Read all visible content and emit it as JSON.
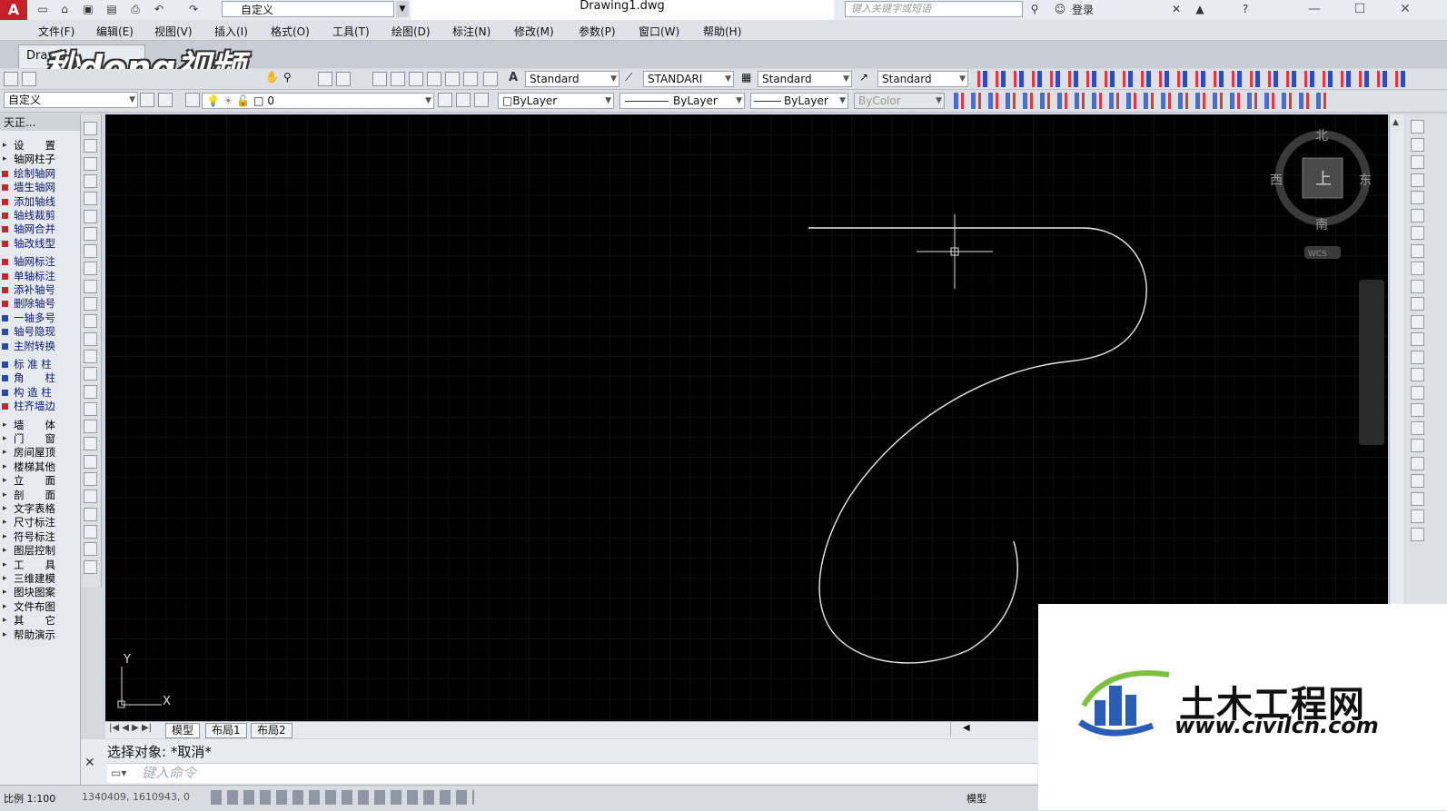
{
  "titlebar": {
    "workspace": "自定义",
    "document_title": "Drawing1.dwg",
    "search_placeholder": "键入关键字或短语",
    "login": "登录"
  },
  "menu": [
    "文件(F)",
    "编辑(E)",
    "视图(V)",
    "插入(I)",
    "格式(O)",
    "工具(T)",
    "绘图(D)",
    "标注(N)",
    "修改(M)",
    "参数(P)",
    "窗口(W)",
    "帮助(H)"
  ],
  "doc_tab": "Draw",
  "watermark_top": "秒dong视频",
  "styles_toolbar": {
    "text_style": "Standard",
    "dim_style": "STANDARI",
    "table_style": "Standard",
    "multileader_style": "Standard"
  },
  "properties_toolbar": {
    "workspace": "自定义",
    "layer": "0",
    "color": "ByLayer",
    "linetype": "ByLayer",
    "lineweight": "ByLayer",
    "plot_style": "ByColor"
  },
  "palette": {
    "title": "天正...",
    "items": [
      {
        "label": "设　　置",
        "type": "cat"
      },
      {
        "label": "轴网柱子",
        "type": "open"
      },
      {
        "label": "绘制轴网",
        "type": "tool",
        "color": "#c0282d"
      },
      {
        "label": "墙生轴网",
        "type": "tool",
        "color": "#c0282d"
      },
      {
        "label": "添加轴线",
        "type": "tool",
        "color": "#c0282d"
      },
      {
        "label": "轴线裁剪",
        "type": "tool",
        "color": "#c0282d"
      },
      {
        "label": "轴网合并",
        "type": "tool",
        "color": "#c0282d"
      },
      {
        "label": "轴改线型",
        "type": "tool",
        "color": "#c0282d"
      },
      {
        "label": "轴网标注",
        "type": "tool",
        "color": "#c0282d"
      },
      {
        "label": "单轴标注",
        "type": "tool",
        "color": "#c0282d"
      },
      {
        "label": "添补轴号",
        "type": "tool",
        "color": "#c0282d"
      },
      {
        "label": "删除轴号",
        "type": "tool",
        "color": "#c0282d"
      },
      {
        "label": "一轴多号",
        "type": "tool",
        "color": "#2a4aa8"
      },
      {
        "label": "轴号隐现",
        "type": "tool",
        "color": "#2a4aa8"
      },
      {
        "label": "主附转换",
        "type": "tool",
        "color": "#2a4aa8"
      },
      {
        "label": "标 准 柱",
        "type": "tool",
        "color": "#2a4aa8"
      },
      {
        "label": "角　　柱",
        "type": "tool",
        "color": "#2a4aa8"
      },
      {
        "label": "构 造 柱",
        "type": "tool",
        "color": "#2a4aa8"
      },
      {
        "label": "柱齐墙边",
        "type": "tool",
        "color": "#c0282d"
      },
      {
        "label": "墙　　体",
        "type": "cat"
      },
      {
        "label": "门　　窗",
        "type": "cat"
      },
      {
        "label": "房间屋顶",
        "type": "cat"
      },
      {
        "label": "楼梯其他",
        "type": "cat"
      },
      {
        "label": "立　　面",
        "type": "cat"
      },
      {
        "label": "剖　　面",
        "type": "cat"
      },
      {
        "label": "文字表格",
        "type": "cat"
      },
      {
        "label": "尺寸标注",
        "type": "cat"
      },
      {
        "label": "符号标注",
        "type": "cat"
      },
      {
        "label": "图层控制",
        "type": "cat"
      },
      {
        "label": "工　　具",
        "type": "cat"
      },
      {
        "label": "三维建模",
        "type": "cat"
      },
      {
        "label": "图块图案",
        "type": "cat"
      },
      {
        "label": "文件布图",
        "type": "cat"
      },
      {
        "label": "其　　它",
        "type": "cat"
      },
      {
        "label": "帮助演示",
        "type": "cat"
      }
    ]
  },
  "viewcube": {
    "north": "北",
    "south": "南",
    "east": "东",
    "west": "西",
    "face": "上",
    "wcs": "WCS"
  },
  "ucs": {
    "y": "Y",
    "x": "X"
  },
  "layout_tabs": [
    "模型",
    "布局1",
    "布局2"
  ],
  "command": {
    "history": "选择对象: *取消*",
    "placeholder": "键入命令"
  },
  "status": {
    "scale": "比例 1:100",
    "coordinates": "1340409, 1610943, 0",
    "model_label": "模型"
  },
  "brand": {
    "name": "土木工程网",
    "url": "www.civilcn.com"
  },
  "colors": {
    "canvas": "#000000",
    "curve": "#e8e8e8",
    "palette_tool": "#0a1a6a",
    "app_red": "#c8202a"
  }
}
